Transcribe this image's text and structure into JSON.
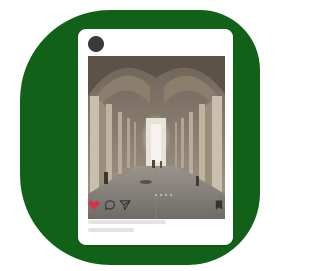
{
  "post": {
    "liked": true,
    "image_count": 5,
    "active_image": 1
  },
  "icons": {
    "like": "heart-icon",
    "comment": "comment-icon",
    "share": "send-icon",
    "save": "bookmark-icon"
  },
  "colors": {
    "tile_background": "#116119",
    "card_background": "#ffffff",
    "avatar": "#3a3a3a",
    "heart": "#d9304a",
    "active_dot": "#4b8ad8",
    "icon_dark": "#333333",
    "placeholder_line": "#e3e3e3"
  }
}
